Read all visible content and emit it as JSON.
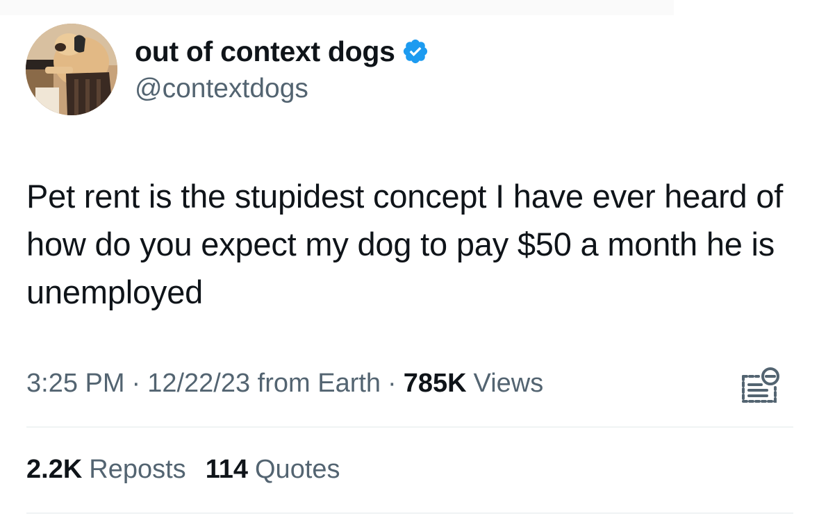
{
  "author": {
    "display_name": "out of context dogs",
    "handle": "@contextdogs",
    "verified": true,
    "verified_color": "#1d9bf0",
    "avatar_icon": "dog-at-computer-avatar"
  },
  "tweet": {
    "text": "Pet rent is the stupidest concept I have ever heard of how do you expect my dog to pay $50 a month he is unemployed"
  },
  "meta": {
    "time": "3:25 PM",
    "separator": "·",
    "date_source": "12/22/23 from Earth",
    "views_count": "785K",
    "views_label": "Views",
    "summary_icon": "post-summary-icon"
  },
  "stats": {
    "reposts_count": "2.2K",
    "reposts_label": "Reposts",
    "quotes_count": "114",
    "quotes_label": "Quotes"
  },
  "colors": {
    "primary_text": "#0f1419",
    "secondary_text": "#536471",
    "divider": "#eff3f4"
  }
}
